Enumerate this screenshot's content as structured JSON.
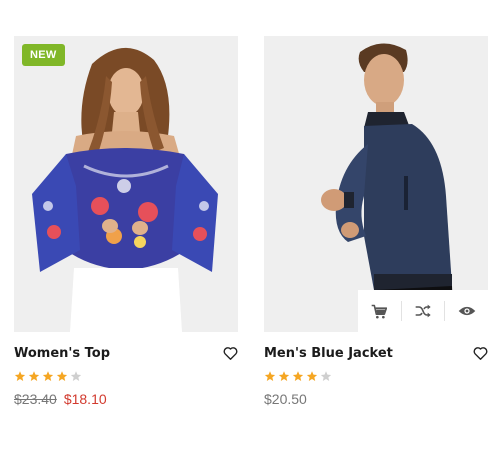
{
  "products": [
    {
      "name": "Women's Top",
      "badge": "NEW",
      "rating": 4,
      "rating_max": 5,
      "old_price": "$23.40",
      "price": "$18.10"
    },
    {
      "name": "Men's Blue Jacket",
      "rating": 4,
      "rating_max": 5,
      "price": "$20.50",
      "actions": [
        "cart-icon",
        "shuffle-icon",
        "eye-icon"
      ]
    }
  ],
  "colors": {
    "badge_green": "#80b728",
    "star_filled": "#f5a623",
    "star_empty": "#cfcfcf",
    "sale_price": "#d23a2e",
    "muted_price": "#777777"
  }
}
